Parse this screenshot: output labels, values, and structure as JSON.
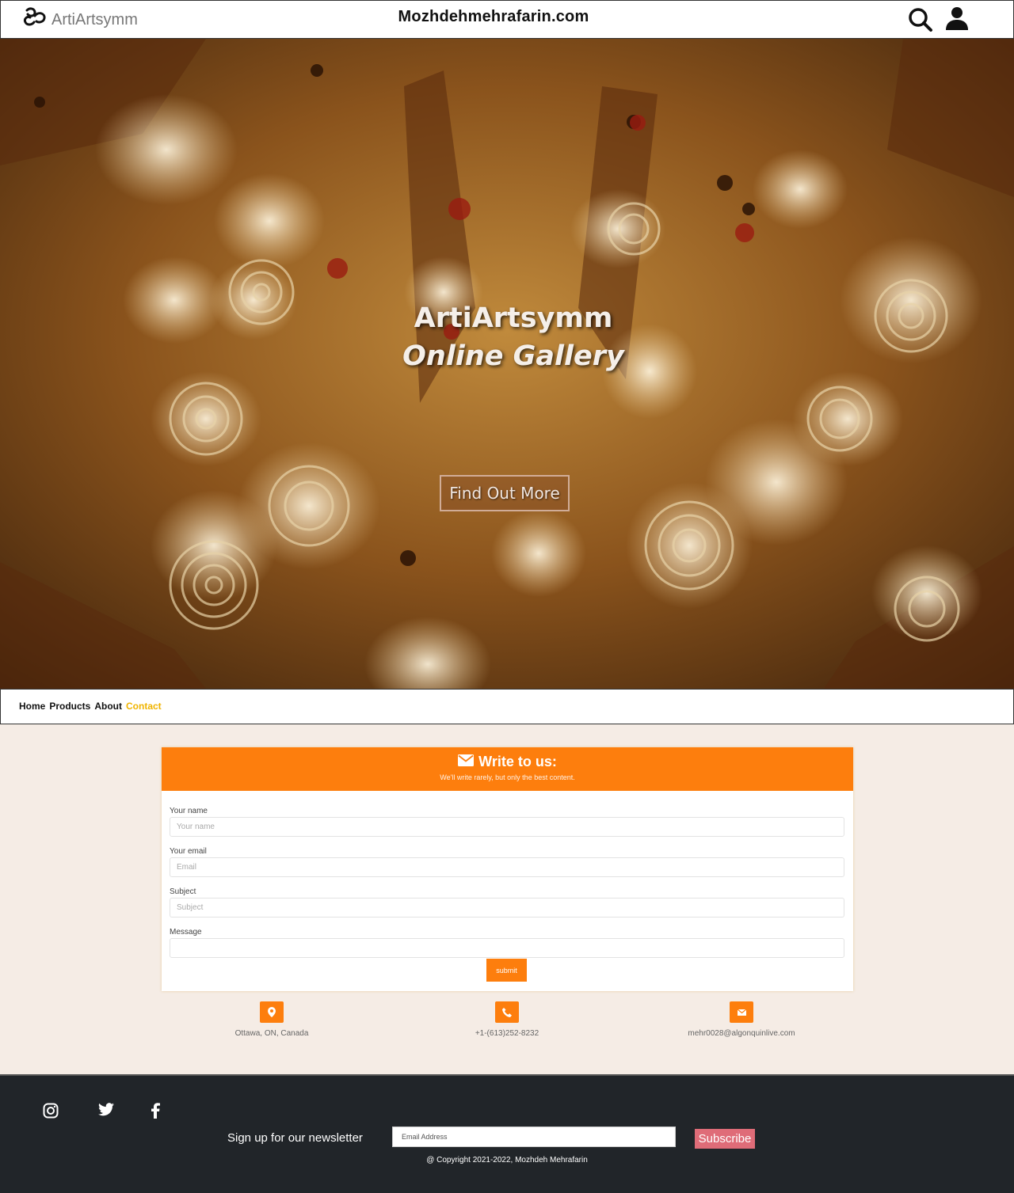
{
  "header": {
    "brand": "ArtiArtsymm",
    "site_title": "Mozhdehmehrafarin.com",
    "icons": [
      "search-icon",
      "user-icon"
    ]
  },
  "hero": {
    "title_line1": "ArtiArtsymm",
    "title_line2": "Online Gallery",
    "button": "Find Out More"
  },
  "nav": {
    "items": [
      "Home",
      "Products",
      "About",
      "Contact"
    ],
    "active": "Contact",
    "active_color": "#f0b400"
  },
  "contact": {
    "heading": "Write to us:",
    "subheading": "We'll write rarely, but only the best content.",
    "fields": [
      {
        "label": "Your name",
        "placeholder": "Your name"
      },
      {
        "label": "Your email",
        "placeholder": "Email"
      },
      {
        "label": "Subject",
        "placeholder": "Subject"
      },
      {
        "label": "Message",
        "placeholder": ""
      }
    ],
    "submit": "submit",
    "accent": "#fd7e0d",
    "info": [
      {
        "icon": "map-marker-icon",
        "text": "Ottawa, ON, Canada"
      },
      {
        "icon": "phone-icon",
        "text": "+1-(613)252-8232"
      },
      {
        "icon": "envelope-icon",
        "text": "mehr0028@algonquinlive.com"
      }
    ]
  },
  "footer": {
    "social": [
      "instagram-icon",
      "twitter-icon",
      "facebook-icon"
    ],
    "newsletter_label": "Sign up for our newsletter",
    "email_placeholder": "Email Address",
    "subscribe": "Subscribe",
    "copyright": "@ Copyright 2021-2022, Mozhdeh Mehrafarin",
    "background": "#212529",
    "button_color": "#df6c78"
  }
}
